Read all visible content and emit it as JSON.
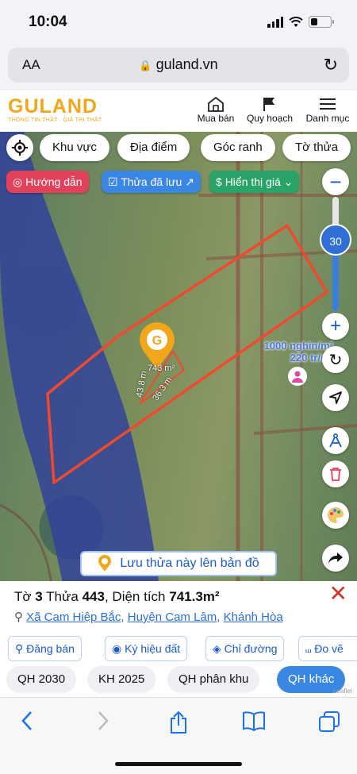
{
  "status": {
    "time": "10:04"
  },
  "browser": {
    "text_size": "AA",
    "url": "guland.vn"
  },
  "brand": {
    "logo": "GULAND",
    "tagline": "THÔNG TIN THẬT · GIÁ TRỊ THẬT",
    "accent": "#f2a71b"
  },
  "nav": [
    {
      "label": "Mua bán",
      "icon": "house-icon"
    },
    {
      "label": "Quy hoạch",
      "icon": "map-flag-icon"
    },
    {
      "label": "Danh mục",
      "icon": "hamburger-icon"
    }
  ],
  "filters": [
    "Khu vực",
    "Địa điểm",
    "Góc ranh",
    "Tờ thửa"
  ],
  "chips": {
    "guide": "Hướng dẫn",
    "saved": "Thửa đã lưu",
    "price": "Hiển thị giá"
  },
  "zoom": {
    "level": "30"
  },
  "plot": {
    "area_label": "743 m²",
    "side_a": "43.8 m",
    "side_b": "36.3 m",
    "price_per_m2": "1000 nghìn/m²",
    "price_total": "220 tr/m²",
    "outline_color": "#f04a2e"
  },
  "save_banner": "Lưu thửa này lên bản đồ",
  "parcel": {
    "sheet_label": "Tờ",
    "sheet": "3",
    "plot_label": "Thửa",
    "plot": "443",
    "area_label": "Diện tích",
    "area": "741.3m²",
    "commune": "Xã Cam Hiệp Bắc",
    "district": "Huyện Cam Lâm",
    "province": "Khánh Hòa"
  },
  "actions": [
    "Đăng bán",
    "Ký hiệu đất",
    "Chỉ đường",
    "Đo vẽ"
  ],
  "layers": [
    {
      "label": "QH 2030",
      "active": false
    },
    {
      "label": "KH 2025",
      "active": false
    },
    {
      "label": "QH phân khu",
      "active": false
    },
    {
      "label": "QH khác",
      "active": true
    }
  ],
  "attribution": "Leaflet"
}
